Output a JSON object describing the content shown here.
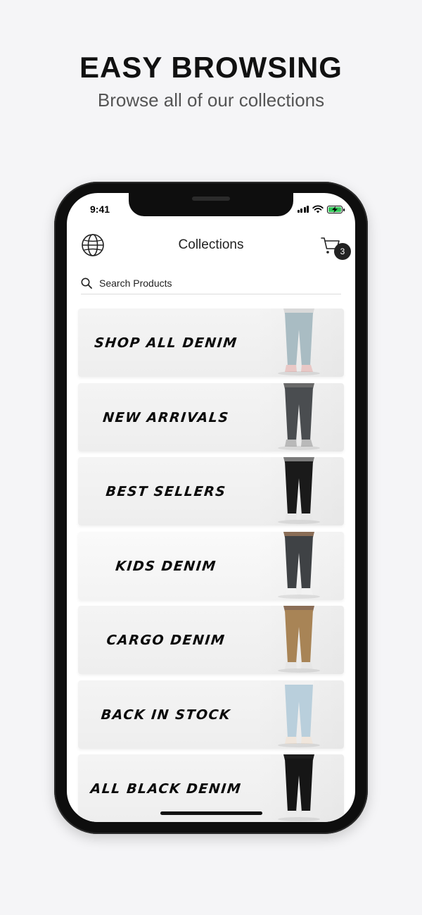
{
  "promo": {
    "title": "EASY BROWSING",
    "subtitle": "Browse all of our collections"
  },
  "status_bar": {
    "time": "9:41",
    "battery_color": "#34c759"
  },
  "header": {
    "title": "Collections",
    "left_icon": "globe-icon",
    "right_icon": "cart-icon",
    "cart_count": "3"
  },
  "search": {
    "placeholder": "Search Products",
    "icon": "search-icon"
  },
  "collections": [
    {
      "label": "SHOP ALL DENIM",
      "pants_color": "#a9bcc3",
      "shoe_color": "#e9c8c6",
      "top_color": "#d9d9d9"
    },
    {
      "label": "NEW ARRIVALS",
      "pants_color": "#4a4d50",
      "shoe_color": "#b9b9b9",
      "top_color": "#6a6a6a"
    },
    {
      "label": "BEST SELLERS",
      "pants_color": "#1a1a1a",
      "shoe_color": "#e8e8e8",
      "top_color": "#7a7a7a"
    },
    {
      "label": "KIDS DENIM",
      "pants_color": "#3f4245",
      "shoe_color": "#f2f2f2",
      "top_color": "#8a6d56"
    },
    {
      "label": "CARGO DENIM",
      "pants_color": "#a88456",
      "shoe_color": "#e6e6e6",
      "top_color": "#8a6d56"
    },
    {
      "label": "BACK IN STOCK",
      "pants_color": "#b9cfdc",
      "shoe_color": "#f0e6dc",
      "top_color": "#f1f1f1"
    },
    {
      "label": "ALL BLACK DENIM",
      "pants_color": "#161616",
      "shoe_color": "#ebebeb",
      "top_color": "#1d1d1d"
    }
  ]
}
